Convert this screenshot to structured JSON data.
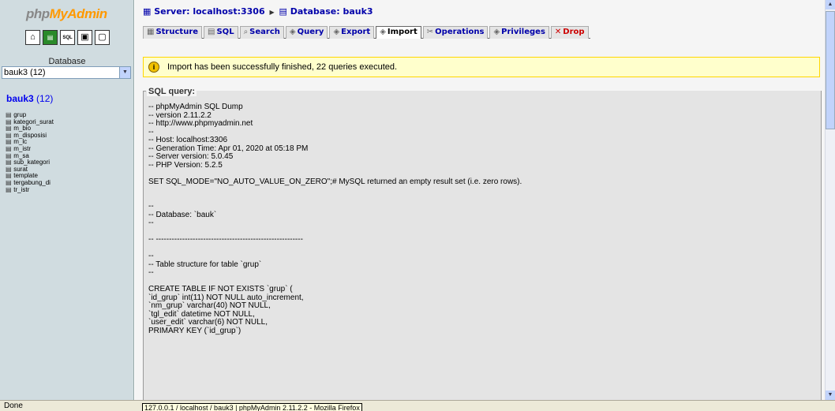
{
  "logo": {
    "php": "php",
    "my": "My",
    "admin": "Admin"
  },
  "toolbar_icons": [
    "home-icon",
    "query-window-icon",
    "sql-icon",
    "docs-icon",
    "help-icon"
  ],
  "left": {
    "db_label": "Database",
    "db_select": "bauk3 (12)",
    "db_title_name": "bauk3",
    "db_title_count": " (12)",
    "tables": [
      "grup",
      "kategori_surat",
      "m_bio",
      "m_disposisi",
      "m_lc",
      "m_istr",
      "m_sa",
      "sub_kategori",
      "surat",
      "template",
      "tergabung_di",
      "tr_istr"
    ]
  },
  "breadcrumb": {
    "server": "Server: localhost:3306",
    "database": "Database: bauk3"
  },
  "tabs": [
    {
      "label": "Structure",
      "icon": "structure-icon"
    },
    {
      "label": "SQL",
      "icon": "sql-icon"
    },
    {
      "label": "Search",
      "icon": "search-icon"
    },
    {
      "label": "Query",
      "icon": "query-icon"
    },
    {
      "label": "Export",
      "icon": "export-icon"
    },
    {
      "label": "Import",
      "icon": "import-icon",
      "active": true
    },
    {
      "label": "Operations",
      "icon": "operations-icon"
    },
    {
      "label": "Privileges",
      "icon": "privileges-icon"
    },
    {
      "label": "Drop",
      "icon": "drop-icon"
    }
  ],
  "notice": "Import has been successfully finished, 22 queries executed.",
  "sql_legend": "SQL query:",
  "sql_lines": [
    "-- phpMyAdmin SQL Dump",
    "-- version 2.11.2.2",
    "-- http://www.phpmyadmin.net",
    "--",
    "-- Host: localhost:3306",
    "-- Generation Time: Apr 01, 2020 at 05:18 PM",
    "-- Server version: 5.0.45",
    "-- PHP Version: 5.2.5",
    "",
    "SET SQL_MODE=\"NO_AUTO_VALUE_ON_ZERO\";# MySQL returned an empty result set (i.e. zero rows).",
    "",
    "",
    "--",
    "-- Database: `bauk`",
    "--",
    "",
    "-- --------------------------------------------------------",
    "",
    "--",
    "-- Table structure for table `grup`",
    "--",
    "",
    "CREATE TABLE IF NOT EXISTS `grup` (",
    "`id_grup` int(11) NOT NULL auto_increment,",
    "`nm_grup` varchar(40) NOT NULL,",
    "`tgl_edit` datetime NOT NULL,",
    "`user_edit` varchar(6) NOT NULL,",
    "PRIMARY KEY (`id_grup`)"
  ],
  "status": "Done",
  "tooltip": "127.0.0.1 / localhost / bauk3 | phpMyAdmin 2.11.2.2 - Mozilla Firefox"
}
